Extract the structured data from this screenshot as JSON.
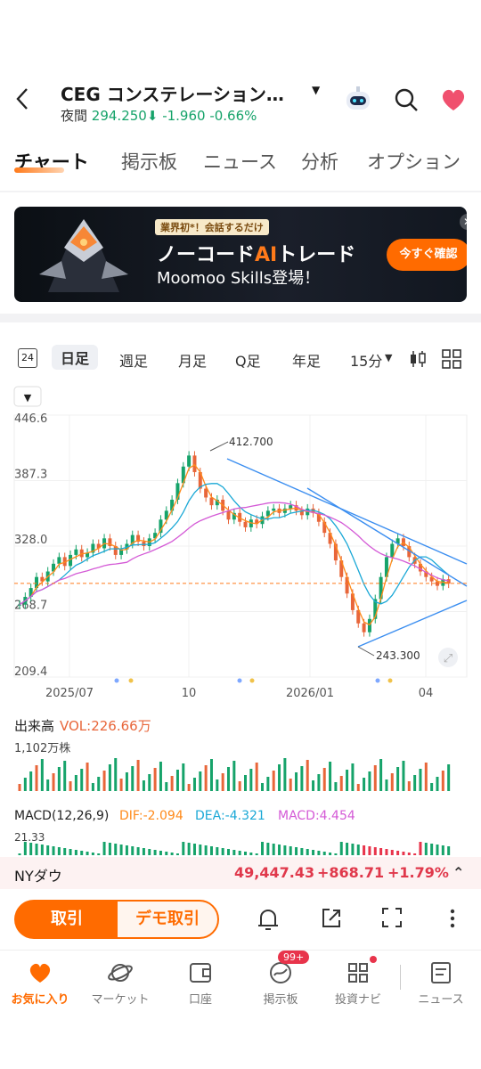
{
  "header": {
    "title": "CEG  コンステレーション…",
    "session_label": "夜間",
    "price": "294.250",
    "change": "-1.960",
    "change_pct": "-0.66%"
  },
  "tabs": [
    "チャート",
    "掲示板",
    "ニュース",
    "分析",
    "オプション"
  ],
  "banner": {
    "tag": "業界初*！会話するだけ",
    "headline_pre": "ノーコード",
    "headline_ai": "AI",
    "headline_post": "トレード",
    "subline": "Moomoo Skills登場！",
    "cta": "今すぐ確認"
  },
  "periods": {
    "icon_24": "24",
    "items": [
      "日足",
      "週足",
      "月足",
      "Q足",
      "年足",
      "15分"
    ],
    "active": "日足"
  },
  "chart_data": {
    "type": "line",
    "y_ticks": [
      "446.6",
      "387.3",
      "328.0",
      "268.7",
      "209.4"
    ],
    "x_ticks": [
      "2025/07",
      "10",
      "2026/01",
      "04"
    ],
    "ylim": [
      209.4,
      446.6
    ],
    "annotations": {
      "high": "412.700",
      "low": "243.300"
    },
    "current_price_line": 294.25,
    "volume": {
      "label": "出来高",
      "vol": "VOL:226.66万",
      "max_label": "1,102万株"
    },
    "macd": {
      "label": "MACD(12,26,9)",
      "dif": "DIF:-2.094",
      "dea": "DEA:-4.321",
      "macd": "MACD:4.454",
      "tick_top": "21.33"
    }
  },
  "ticker": {
    "name": "NYダウ",
    "value": "49,447.43",
    "change": "+868.71",
    "pct": "+1.79%"
  },
  "actions": {
    "trade": "取引",
    "demo": "デモ取引"
  },
  "nav": {
    "items": [
      "お気に入り",
      "マーケット",
      "口座",
      "掲示板",
      "投資ナビ",
      "ニュース"
    ],
    "badge": "99+"
  }
}
